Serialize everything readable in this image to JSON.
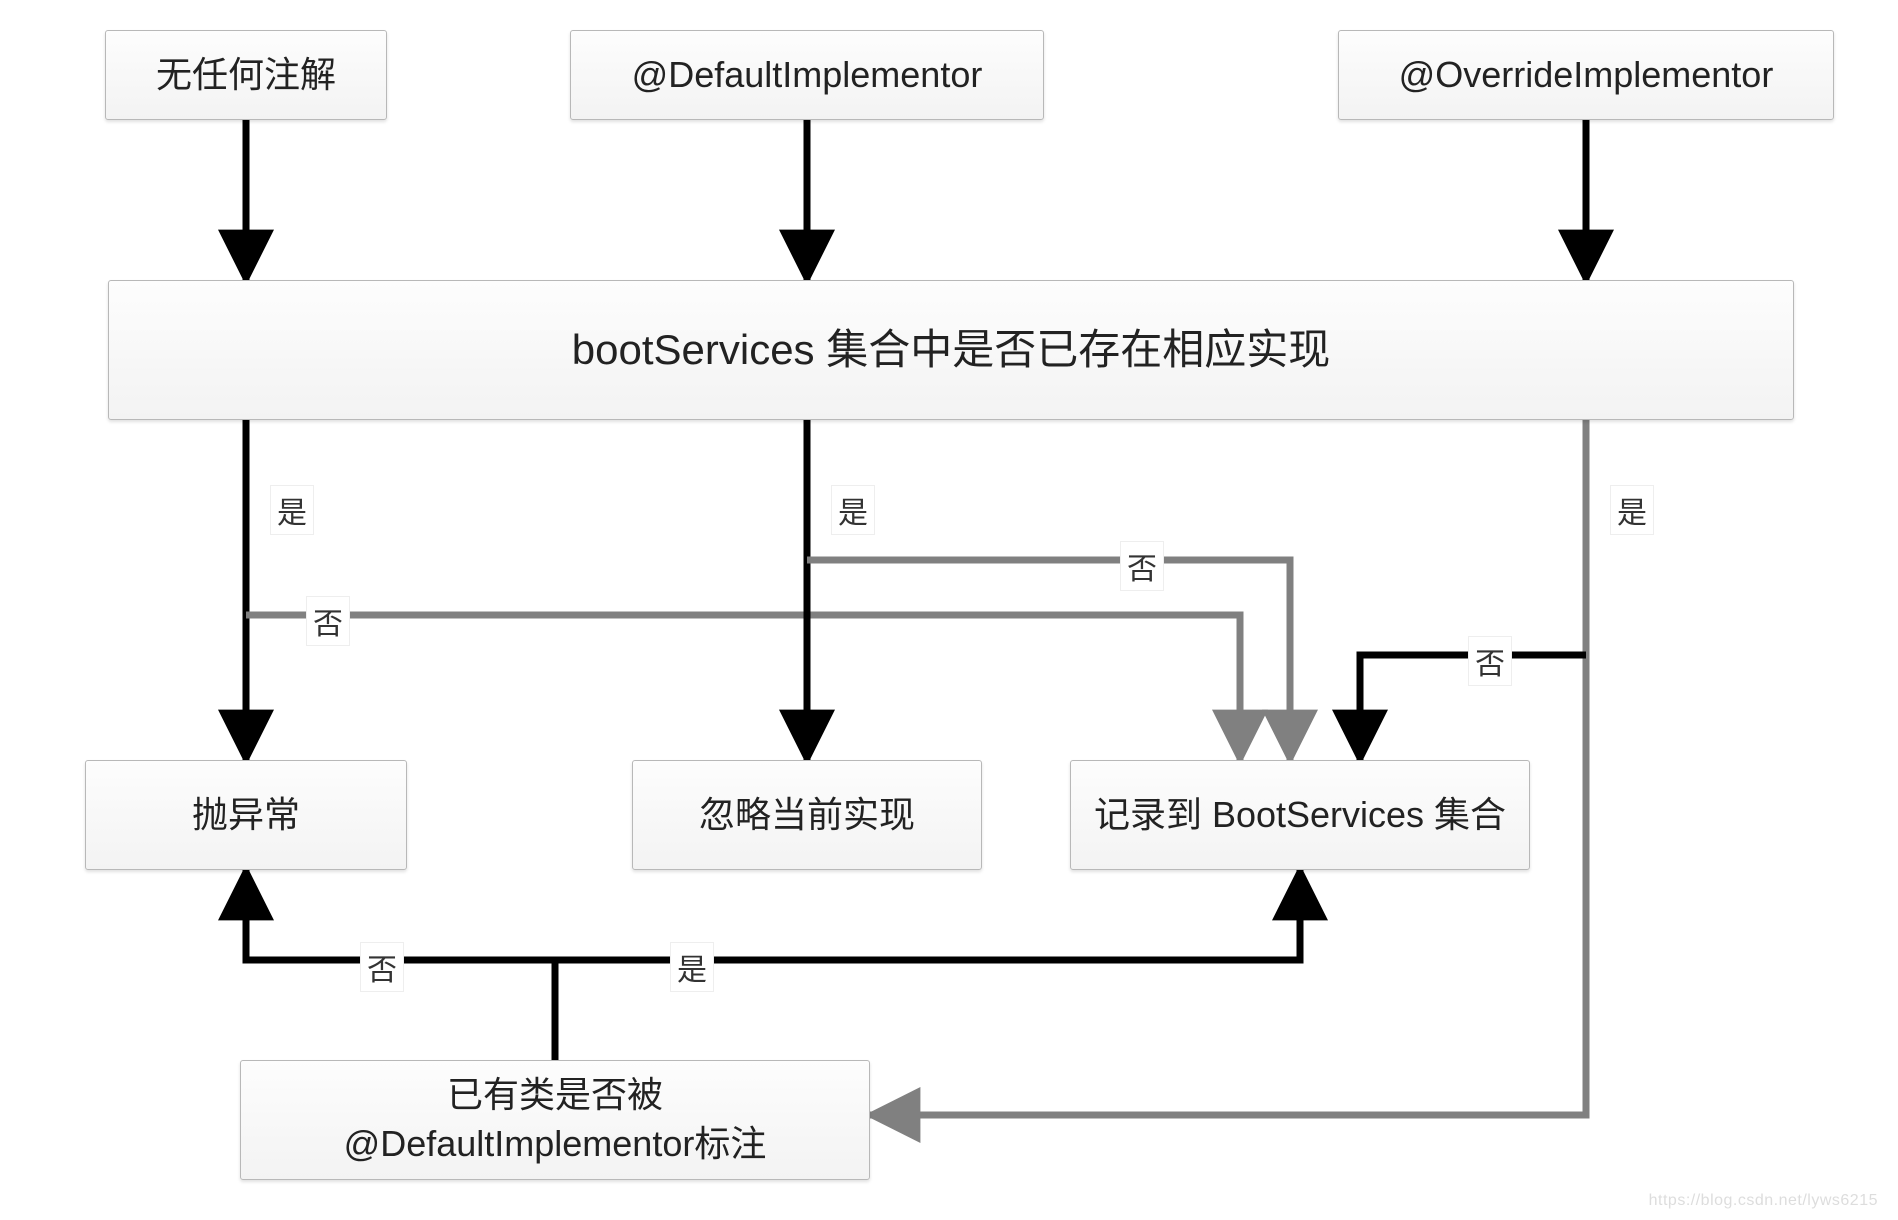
{
  "nodes": {
    "noAnnotation": "无任何注解",
    "defaultImplementor": "@DefaultImplementor",
    "overrideImplementor": "@OverrideImplementor",
    "checkExists": "bootServices 集合中是否已存在相应实现",
    "throwException": "抛异常",
    "ignoreCurrent": "忽略当前实现",
    "recordToBoot": "记录到 BootServices 集合",
    "checkDefaultAnnotated": "已有类是否被\n@DefaultImplementor标注"
  },
  "labels": {
    "yes": "是",
    "no": "否"
  },
  "watermark": "https://blog.csdn.net/lyws6215",
  "edges": [
    {
      "from": "noAnnotation",
      "to": "checkExists",
      "label": null
    },
    {
      "from": "defaultImplementor",
      "to": "checkExists",
      "label": null
    },
    {
      "from": "overrideImplementor",
      "to": "checkExists",
      "label": null
    },
    {
      "from": "checkExists",
      "via": "noAnnotation-path",
      "to": "throwException",
      "label": "是"
    },
    {
      "from": "checkExists",
      "via": "noAnnotation-path",
      "to": "recordToBoot",
      "label": "否"
    },
    {
      "from": "checkExists",
      "via": "defaultImplementor-path",
      "to": "ignoreCurrent",
      "label": "是"
    },
    {
      "from": "checkExists",
      "via": "defaultImplementor-path",
      "to": "recordToBoot",
      "label": "否"
    },
    {
      "from": "checkExists",
      "via": "overrideImplementor-path",
      "to": "checkDefaultAnnotated",
      "label": "是"
    },
    {
      "from": "checkExists",
      "via": "overrideImplementor-path",
      "to": "recordToBoot",
      "label": "否"
    },
    {
      "from": "checkDefaultAnnotated",
      "to": "throwException",
      "label": "否"
    },
    {
      "from": "checkDefaultAnnotated",
      "to": "recordToBoot",
      "label": "是"
    }
  ]
}
